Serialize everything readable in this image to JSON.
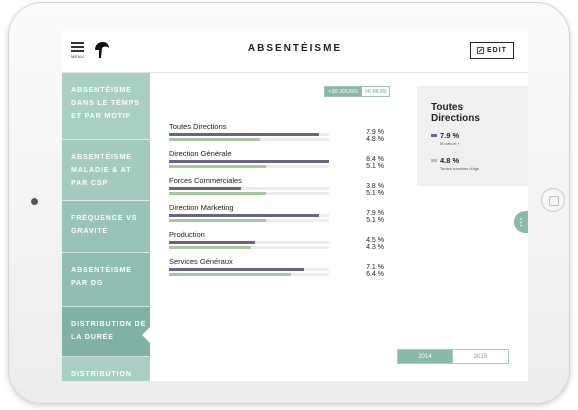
{
  "header": {
    "menu_label": "MENU",
    "title": "ABSENTÉISME",
    "edit_label": "EDIT"
  },
  "sidebar": {
    "items": [
      {
        "label": "ABSENTÉISME DANS LE TEMPS ET PAR MOTIF",
        "color": "#a9cfc5"
      },
      {
        "label": "ABSENTÉISME MALADIE & AT PAR CSP",
        "color": "#a2cabf"
      },
      {
        "label": "FRÉQUENCE VS GRAVITÉ",
        "color": "#98c3b8"
      },
      {
        "label": "ABSENTÉISME PAR DG",
        "color": "#8fbdb1"
      },
      {
        "label": "DISTRIBUTION DE LA DURÉE",
        "color": "#7fb2a4",
        "active": true
      },
      {
        "label": "DISTRIBUTION",
        "color": "#a9cfc5"
      }
    ]
  },
  "filter": {
    "active": "<30 JOURS",
    "inactive": ">6 MOIS"
  },
  "colors": {
    "series_a": "#6b6386",
    "series_b": "#a8c899",
    "accent": "#8ab9ab"
  },
  "chart_data": {
    "type": "bar",
    "categories": [
      "Toutes Directions",
      "Direction Générale",
      "Forces Commerciales",
      "Direction Marketing",
      "Production",
      "Services Généraux"
    ],
    "series": [
      {
        "name": "50 ans et +",
        "values": [
          7.9,
          8.4,
          3.8,
          7.9,
          4.5,
          7.1
        ],
        "labels": [
          "7.9 %",
          "8.4 %",
          "3.8 %",
          "7.9 %",
          "4.5 %",
          "7.1 %"
        ]
      },
      {
        "name": "Toutes tranches d'âge",
        "values": [
          4.8,
          5.1,
          5.1,
          5.1,
          4.3,
          6.4
        ],
        "labels": [
          "4.8 %",
          "5.1 %",
          "5.1 %",
          "5.1 %",
          "4.3 %",
          "6.4 %"
        ]
      }
    ],
    "xlim": [
      0,
      8.4
    ]
  },
  "panel": {
    "title_line1": "Toutes",
    "title_line2": "Directions",
    "value_a": "7.9 %",
    "sub_a": "50 ans et +",
    "value_b": "4.8 %",
    "sub_b": "Toutes tranches d'âge"
  },
  "side_tab_icon": "⋮",
  "years": {
    "active": "2014",
    "inactive": "2015"
  }
}
